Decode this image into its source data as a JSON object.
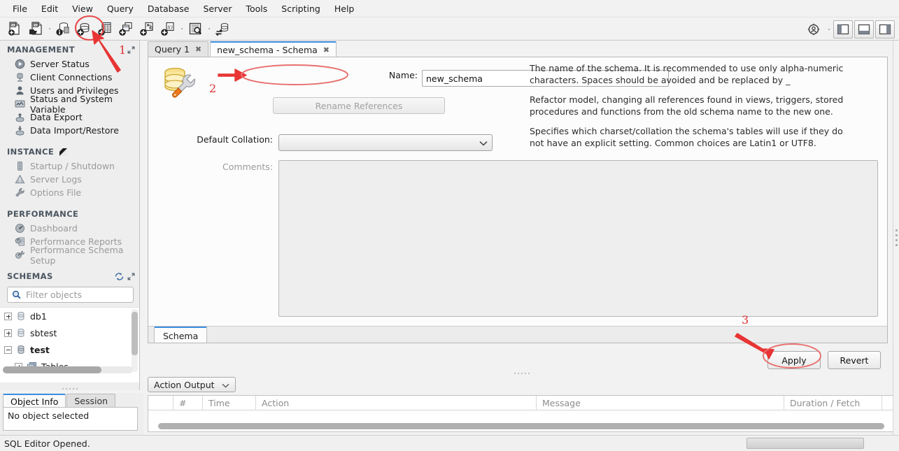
{
  "menu": {
    "items": [
      "File",
      "Edit",
      "View",
      "Query",
      "Database",
      "Server",
      "Tools",
      "Scripting",
      "Help"
    ]
  },
  "toolbar": {
    "buttons": [
      {
        "name": "new-sql-tab-icon",
        "title": "New SQL Tab"
      },
      {
        "name": "open-sql-script-icon",
        "title": "Open SQL Script"
      },
      {
        "name": "connection-info-icon",
        "title": "Connection Info"
      },
      {
        "name": "create-schema-icon",
        "title": "Create a new schema in the connected server"
      },
      {
        "name": "create-table-icon",
        "title": "Create a new table"
      },
      {
        "name": "create-view-icon",
        "title": "Create a new view"
      },
      {
        "name": "create-procedure-icon",
        "title": "Create a new stored procedure"
      },
      {
        "name": "create-function-icon",
        "title": "Create a new function"
      },
      {
        "name": "inspect-object-icon",
        "title": "Inspect selected object"
      },
      {
        "name": "reconnect-server-icon",
        "title": "Reconnect to DBMS"
      }
    ],
    "right_buttons": [
      {
        "name": "scope-icon"
      },
      {
        "name": "toggle-sidebar-icon"
      },
      {
        "name": "toggle-output-icon"
      },
      {
        "name": "toggle-secondary-sidebar-icon"
      }
    ]
  },
  "sidebar": {
    "management": {
      "title": "MANAGEMENT",
      "items": [
        {
          "label": "Server Status",
          "icon": "server-status-icon",
          "disabled": false
        },
        {
          "label": "Client Connections",
          "icon": "client-connections-icon",
          "disabled": false
        },
        {
          "label": "Users and Privileges",
          "icon": "users-privileges-icon",
          "disabled": false
        },
        {
          "label": "Status and System Variable",
          "icon": "status-variables-icon",
          "disabled": false
        },
        {
          "label": "Data Export",
          "icon": "data-export-icon",
          "disabled": false
        },
        {
          "label": "Data Import/Restore",
          "icon": "data-import-icon",
          "disabled": false
        }
      ]
    },
    "instance": {
      "title": "INSTANCE",
      "items": [
        {
          "label": "Startup / Shutdown",
          "icon": "startup-shutdown-icon",
          "disabled": true
        },
        {
          "label": "Server Logs",
          "icon": "server-logs-icon",
          "disabled": true
        },
        {
          "label": "Options File",
          "icon": "options-file-icon",
          "disabled": true
        }
      ]
    },
    "performance": {
      "title": "PERFORMANCE",
      "items": [
        {
          "label": "Dashboard",
          "icon": "dashboard-icon",
          "disabled": true
        },
        {
          "label": "Performance Reports",
          "icon": "performance-reports-icon",
          "disabled": true
        },
        {
          "label": "Performance Schema Setup",
          "icon": "performance-schema-setup-icon",
          "disabled": true
        }
      ]
    },
    "schemas": {
      "title": "SCHEMAS",
      "filter_placeholder": "Filter objects",
      "filter_value": "",
      "tree": [
        {
          "label": "db1",
          "expanded": false,
          "indent": 0,
          "icon": "schema-icon",
          "bold": false
        },
        {
          "label": "sbtest",
          "expanded": false,
          "indent": 0,
          "icon": "schema-icon",
          "bold": false
        },
        {
          "label": "test",
          "expanded": true,
          "indent": 0,
          "icon": "schema-icon",
          "bold": true
        },
        {
          "label": "Tables",
          "expanded": false,
          "indent": 1,
          "icon": "tables-icon",
          "bold": false
        }
      ]
    }
  },
  "object_info": {
    "tabs": [
      {
        "label": "Object Info",
        "active": true
      },
      {
        "label": "Session",
        "active": false
      }
    ],
    "body_text": "No object selected"
  },
  "editor_tabs": [
    {
      "label": "Query 1",
      "active": false,
      "closable": true
    },
    {
      "label": "new_schema - Schema",
      "active": true,
      "closable": true
    }
  ],
  "schema_editor": {
    "icon": "schema-settings-icon",
    "name_label": "Name:",
    "name_value": "new_schema",
    "name_placeholder": "",
    "rename_references_label": "Rename References",
    "collation_label": "Default Collation:",
    "collation_value": "",
    "comments_label": "Comments:",
    "comments_value": "",
    "help": {
      "name": "The name of the schema. It is recommended to use only alpha-numeric characters. Spaces should be avoided and be replaced by _",
      "rename": "Refactor model, changing all references found in views, triggers, stored procedures and functions from the old schema name to the new one.",
      "collation": "Specifies which charset/collation the schema's tables will use if they do not have an explicit setting. Common choices are Latin1 or UTF8."
    },
    "bottom_tab": "Schema",
    "apply_label": "Apply",
    "revert_label": "Revert"
  },
  "output_panel": {
    "selector_label": "Action Output",
    "columns": [
      "",
      "#",
      "Time",
      "Action",
      "Message",
      "Duration / Fetch"
    ],
    "rows": []
  },
  "statusbar": {
    "text": "SQL Editor Opened."
  },
  "annotations": [
    {
      "number": "1",
      "target": "create-schema-toolbar-button"
    },
    {
      "number": "2",
      "target": "schema-name-field"
    },
    {
      "number": "3",
      "target": "apply-button"
    }
  ],
  "colors": {
    "annotation_red": "#e03030",
    "active_tab_accent": "#3b8ede",
    "section_header": "#4a5560",
    "schema_icon_yellow": "#f5d76e"
  }
}
